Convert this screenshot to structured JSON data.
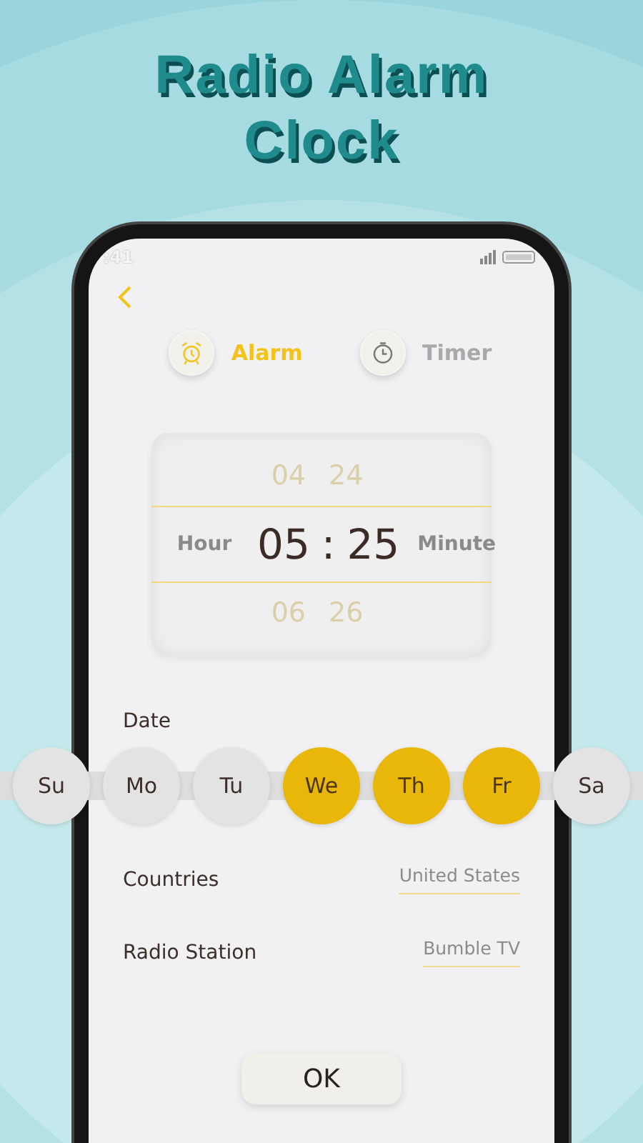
{
  "headline": "Radio Alarm Clock",
  "status_bar": {
    "time": ":41"
  },
  "tabs": [
    {
      "label": "Alarm",
      "kind": "alarm",
      "selected": true
    },
    {
      "label": "Timer",
      "kind": "timer",
      "selected": false
    }
  ],
  "time_picker": {
    "hour_label": "Hour",
    "minute_label": "Minute",
    "separator": ":",
    "rows": [
      {
        "hour": "04",
        "minute": "24",
        "selected": false
      },
      {
        "hour": "05",
        "minute": "25",
        "selected": true
      },
      {
        "hour": "06",
        "minute": "26",
        "selected": false
      }
    ]
  },
  "date": {
    "label": "Date",
    "days": [
      {
        "label": "Su",
        "selected": false
      },
      {
        "label": "Mo",
        "selected": false
      },
      {
        "label": "Tu",
        "selected": false
      },
      {
        "label": "We",
        "selected": true
      },
      {
        "label": "Th",
        "selected": true
      },
      {
        "label": "Fr",
        "selected": true
      },
      {
        "label": "Sa",
        "selected": false
      }
    ]
  },
  "settings": [
    {
      "label": "Countries",
      "value": "United States"
    },
    {
      "label": "Radio Station",
      "value": "Bumble TV"
    }
  ],
  "ok_button": "OK"
}
